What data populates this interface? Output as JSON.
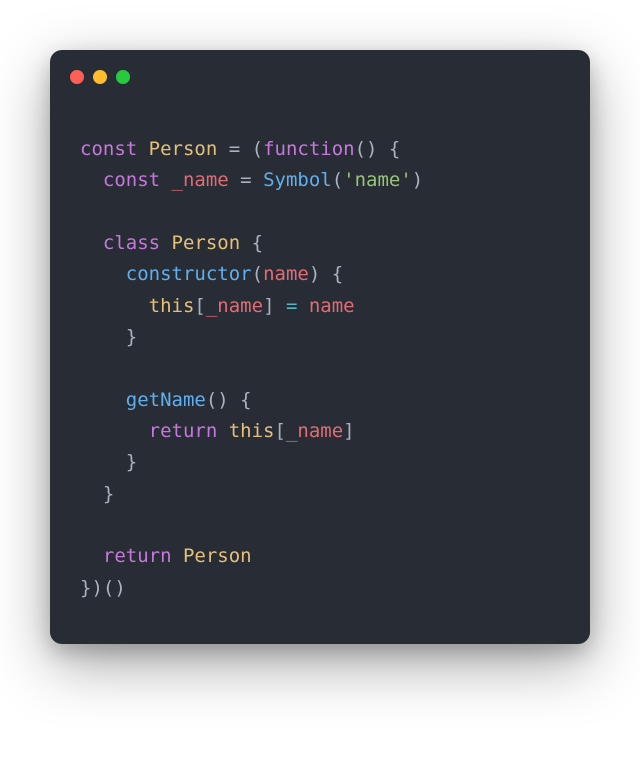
{
  "titlebar": {
    "dots": [
      "red",
      "yellow",
      "green"
    ]
  },
  "code": {
    "t1_const": "const",
    "t1_Person": "Person",
    "t1_eq": " = (",
    "t1_function": "function",
    "t1_paren": "() {",
    "t2_const": "const",
    "t2_name": " _name",
    "t2_eq": " = ",
    "t2_Symbol": "Symbol",
    "t2_open": "(",
    "t2_str": "'name'",
    "t2_close": ")",
    "t4_class": "class",
    "t4_Person": " Person",
    "t4_brace": " {",
    "t5_constructor": "constructor",
    "t5_open": "(",
    "t5_arg": "name",
    "t5_close": ") {",
    "t6_this": "this",
    "t6_open": "[",
    "t6_name": "_name",
    "t6_close": "] ",
    "t6_eq": "=",
    "t6_val": " name",
    "t7_close": "}",
    "t9_getName": "getName",
    "t9_paren": "() {",
    "t10_return": "return",
    "t10_this": " this",
    "t10_open": "[",
    "t10_name": "_name",
    "t10_close": "]",
    "t11_close": "}",
    "t12_close": "}",
    "t14_return": "return",
    "t14_Person": " Person",
    "t15_close": "})()"
  }
}
